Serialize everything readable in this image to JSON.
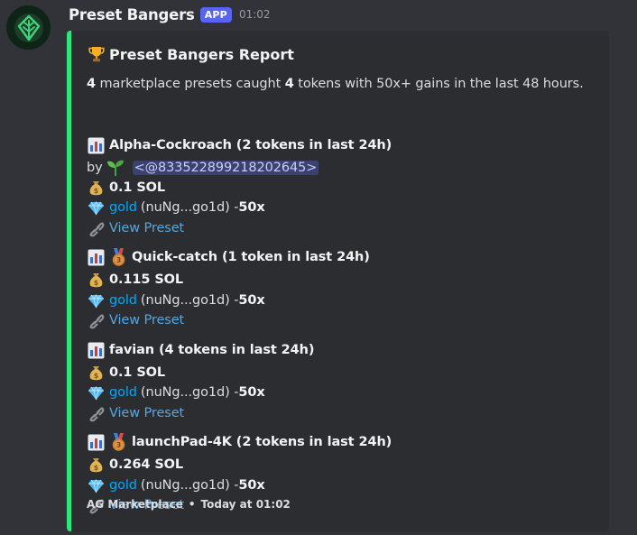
{
  "message": {
    "author": "Preset Bangers",
    "badge": "APP",
    "time": "01:02"
  },
  "embed": {
    "title_icon": "trophy-icon",
    "title": "Preset Bangers Report",
    "desc_count_presets": "4",
    "desc_part1": " marketplace presets caught ",
    "desc_count_tokens": "4",
    "desc_part2": " tokens with 50x+ gains in the last 48 hours.",
    "presets": [
      {
        "name": "Alpha-Cockroach (2 tokens in last 24h)",
        "by_label": "by",
        "by_mention": "<@833522899218202645>",
        "amount": "0.1 SOL",
        "token_name": "gold",
        "token_addr": "(nuNg...go1d) - ",
        "gain": "50x",
        "link_label": "View Preset"
      },
      {
        "name": "Quick-catch (1 token in last 24h)",
        "medal": "bronze-medal-icon",
        "amount": "0.115 SOL",
        "token_name": "gold",
        "token_addr": "(nuNg...go1d) - ",
        "gain": "50x",
        "link_label": "View Preset"
      },
      {
        "name": "favian (4 tokens in last 24h)",
        "amount": "0.1 SOL",
        "token_name": "gold",
        "token_addr": "(nuNg...go1d) - ",
        "gain": "50x",
        "link_label": "View Preset"
      },
      {
        "name": "launchPad-4K (2 tokens in last 24h)",
        "medal": "bronze-medal-icon",
        "amount": "0.264 SOL",
        "token_name": "gold",
        "token_addr": "(nuNg...go1d) - ",
        "gain": "50x",
        "link_label": "View Preset"
      }
    ],
    "footer_source": "AG Marketplace",
    "footer_sep": "•",
    "footer_time": "Today at 01:02"
  },
  "colors": {
    "accent_bar": "#2fe57c",
    "badge": "#5865f2",
    "link": "#00a8fc",
    "background": "#323339",
    "embed_bg": "#2b2d31"
  }
}
